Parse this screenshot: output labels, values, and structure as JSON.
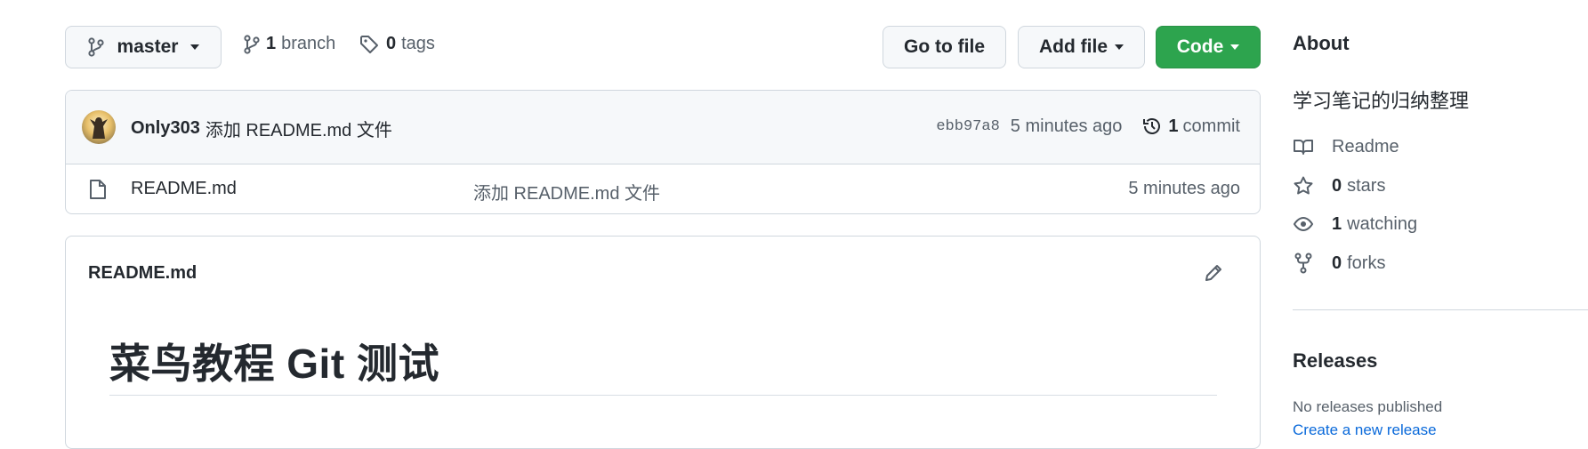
{
  "toolbar": {
    "branch_select": "master",
    "branches_count": "1",
    "branches_label": "branch",
    "tags_count": "0",
    "tags_label": "tags",
    "go_to_file": "Go to file",
    "add_file": "Add file",
    "code": "Code"
  },
  "commit_bar": {
    "author": "Only303",
    "message": "添加 README.md 文件",
    "sha": "ebb97a8",
    "time": "5 minutes ago",
    "commit_count": "1",
    "commit_label": "commit"
  },
  "files": [
    {
      "name": "README.md",
      "message": "添加 README.md 文件",
      "time": "5 minutes ago",
      "icon": "file-icon"
    }
  ],
  "readme": {
    "filename": "README.md",
    "heading": "菜鸟教程 Git 测试"
  },
  "about": {
    "title": "About",
    "description": "学习笔记的归纳整理",
    "readme_label": "Readme",
    "stars_count": "0",
    "stars_label": "stars",
    "watching_count": "1",
    "watching_label": "watching",
    "forks_count": "0",
    "forks_label": "forks"
  },
  "releases": {
    "title": "Releases",
    "none_text": "No releases published",
    "create_link": "Create a new release"
  },
  "colors": {
    "accent_green": "#2da44e",
    "link_blue": "#0969da",
    "border": "#d0d7de",
    "muted": "#57606a"
  }
}
